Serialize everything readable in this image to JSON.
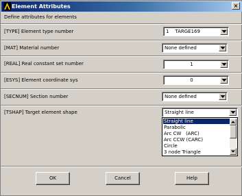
{
  "window": {
    "title": "Element Attributes",
    "close_glyph": "×",
    "app_icon": "ansys-logo-icon"
  },
  "header": {
    "instruction": "Define attributes for elements"
  },
  "fields": {
    "type": {
      "label": "[TYPE]  Element type number",
      "value": "1    TARGE169"
    },
    "mat": {
      "label": "[MAT]   Material number",
      "value": "None defined"
    },
    "real": {
      "label": "[REAL]  Real constant set number",
      "value": "1"
    },
    "esys": {
      "label": "[ESYS]  Element coordinate sys",
      "value": "0"
    },
    "secnum": {
      "label": "[SECNUM]  Section number",
      "value": "None defined"
    },
    "tshap": {
      "label": "[TSHAP]  Target element shape",
      "value": "Straight line",
      "options": [
        "Straight line",
        "Parabolic",
        "Arc CW   (ARC)",
        "Arc CCW (CARC)",
        "Circle",
        "3 node Triangle"
      ],
      "selected_index": 0
    }
  },
  "buttons": {
    "ok": "OK",
    "cancel": "Cancel",
    "help": "Help"
  },
  "colors": {
    "title_bar": "#0a246a",
    "dialog_bg": "#d4d0c8",
    "selection": "#0a246a"
  }
}
